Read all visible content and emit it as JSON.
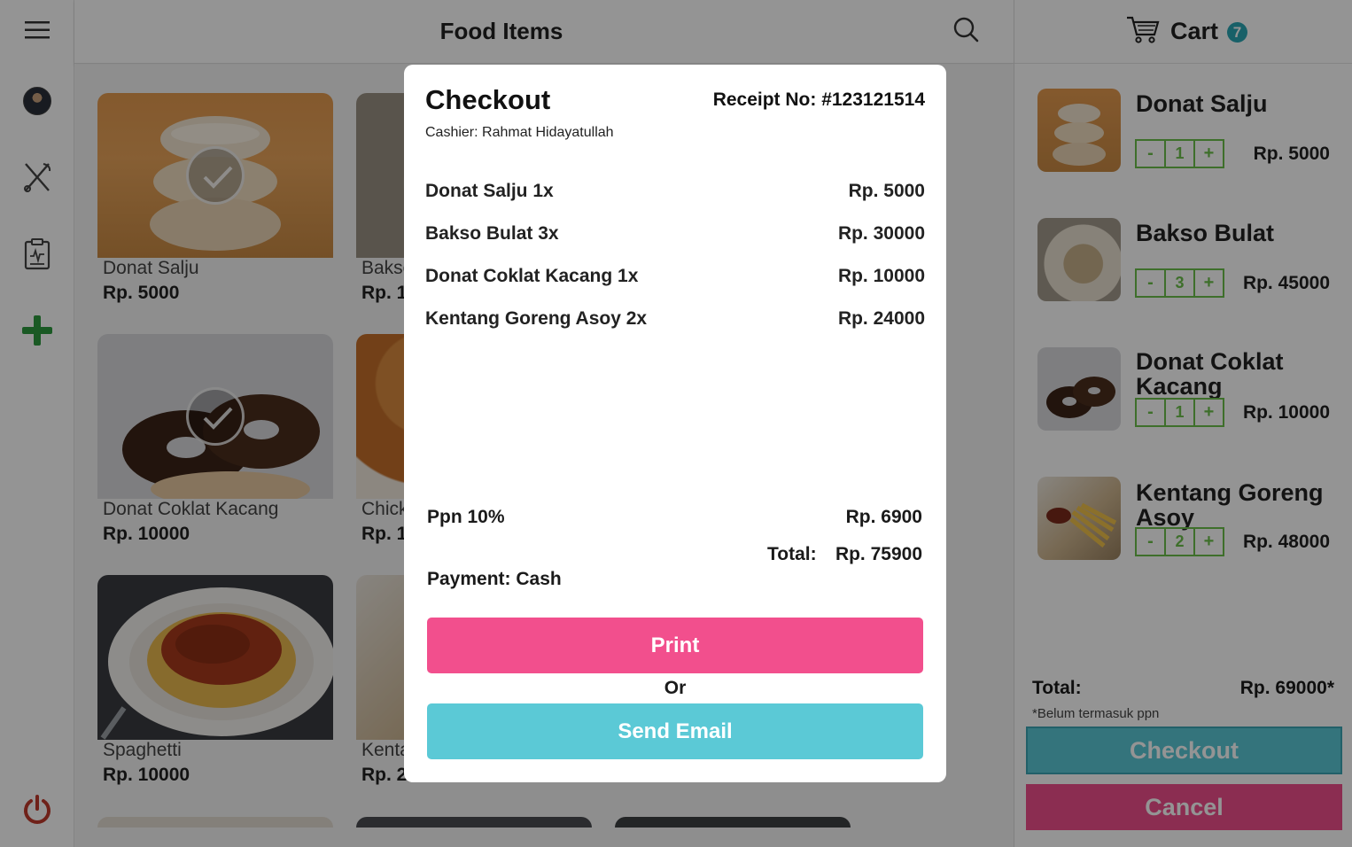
{
  "header": {
    "title": "Food Items"
  },
  "sidebar": {
    "icons": [
      "avatar",
      "utensils-icon",
      "clipboard-icon",
      "plus-icon",
      "power-icon"
    ]
  },
  "menu": {
    "items": [
      {
        "name": "Donat Salju",
        "price": "Rp. 5000",
        "selected": true
      },
      {
        "name": "Bakso Bulat",
        "price": "Rp. 15000",
        "selected": false
      },
      {
        "name": "Donat Coklat Kacang",
        "price": "Rp. 10000",
        "selected": true
      },
      {
        "name": "Chicken",
        "price": "Rp. 12000",
        "selected": false
      },
      {
        "name": "Spaghetti",
        "price": "Rp. 10000",
        "selected": false
      },
      {
        "name": "Kentang Goreng Asoy",
        "price": "Rp. 24000",
        "selected": false
      }
    ]
  },
  "cart": {
    "title": "Cart",
    "count": "7",
    "items": [
      {
        "name": "Donat Salju",
        "qty": "1",
        "price": "Rp. 5000"
      },
      {
        "name": "Bakso Bulat",
        "qty": "3",
        "price": "Rp. 45000"
      },
      {
        "name": "Donat Coklat Kacang",
        "qty": "1",
        "price": "Rp. 10000"
      },
      {
        "name": "Kentang Goreng Asoy",
        "qty": "2",
        "price": "Rp. 48000"
      }
    ],
    "minus_label": "-",
    "plus_label": "+",
    "total_label": "Total:",
    "total_value": "Rp. 69000*",
    "note": "*Belum termasuk ppn",
    "checkout_label": "Checkout",
    "cancel_label": "Cancel"
  },
  "modal": {
    "title": "Checkout",
    "receipt_no": "Receipt No: #123121514",
    "cashier": "Cashier: Rahmat Hidayatullah",
    "lines": [
      {
        "name": "Donat Salju 1x",
        "price": "Rp. 5000"
      },
      {
        "name": "Bakso Bulat 3x",
        "price": "Rp. 30000"
      },
      {
        "name": "Donat Coklat Kacang 1x",
        "price": "Rp. 10000"
      },
      {
        "name": "Kentang Goreng Asoy 2x",
        "price": "Rp. 24000"
      }
    ],
    "ppn_label": "Ppn 10%",
    "ppn_value": "Rp. 6900",
    "total_label": "Total:",
    "total_value": "Rp. 75900",
    "payment": "Payment: Cash",
    "print_label": "Print",
    "or_label": "Or",
    "email_label": "Send Email"
  },
  "colors": {
    "accent_pink": "#f24f8d",
    "accent_teal": "#5bc9d6",
    "stepper_green": "#6cc04a",
    "plus_green": "#2e9a3f",
    "power_red": "#c0392b"
  }
}
